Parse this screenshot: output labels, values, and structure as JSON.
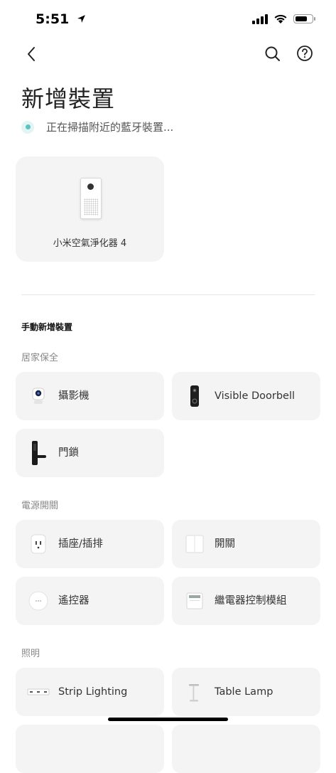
{
  "status_bar": {
    "time": "5:51",
    "battery_level": 0.78
  },
  "title": "新增裝置",
  "scan_text": "正在掃描附近的藍牙裝置...",
  "found_devices": [
    {
      "name": "小米空氣淨化器 4",
      "icon": "air-purifier-icon"
    }
  ],
  "manual_title": "手動新增裝置",
  "categories": [
    {
      "label": "居家保全",
      "items": [
        {
          "name": "攝影機",
          "icon": "camera-icon"
        },
        {
          "name": "Visible Doorbell",
          "icon": "doorbell-icon"
        },
        {
          "name": "門鎖",
          "icon": "door-lock-icon"
        }
      ]
    },
    {
      "label": "電源開關",
      "items": [
        {
          "name": "插座/插排",
          "icon": "outlet-icon"
        },
        {
          "name": "開關",
          "icon": "switch-icon"
        },
        {
          "name": "遙控器",
          "icon": "remote-icon"
        },
        {
          "name": "繼電器控制模組",
          "icon": "relay-module-icon"
        }
      ]
    },
    {
      "label": "照明",
      "items": [
        {
          "name": "Strip Lighting",
          "icon": "strip-light-icon"
        },
        {
          "name": "Table Lamp",
          "icon": "table-lamp-icon"
        }
      ]
    }
  ],
  "colors": {
    "accent": "#5bc4c2",
    "card_bg": "#f4f4f4",
    "text": "#222222"
  }
}
